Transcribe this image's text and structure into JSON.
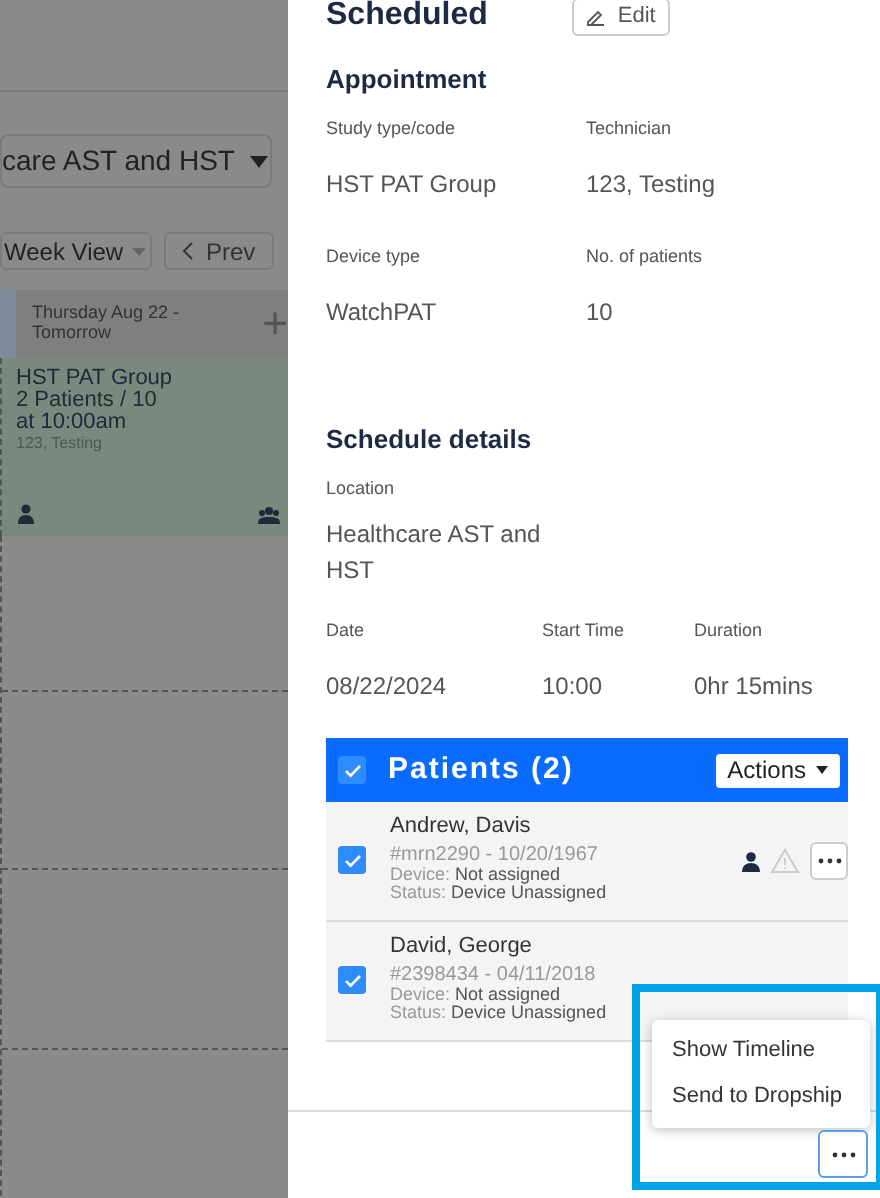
{
  "background": {
    "location_select": "care AST and HST",
    "view_select": "Week View",
    "prev_button": "Prev",
    "day_header": "Thursday Aug 22 - Tomorrow",
    "add_button": "+",
    "event": {
      "title": "HST PAT Group",
      "patients": "2 Patients / 10",
      "time": "at 10:00am",
      "technician": "123, Testing"
    }
  },
  "drawer": {
    "title": "Scheduled",
    "edit_button": "Edit",
    "appointment": {
      "heading": "Appointment",
      "fields": [
        {
          "label": "Study type/code",
          "value": "HST PAT Group"
        },
        {
          "label": "Technician",
          "value": "123, Testing"
        },
        {
          "label": "Device type",
          "value": "WatchPAT"
        },
        {
          "label": "No. of patients",
          "value": "10"
        }
      ]
    },
    "schedule": {
      "heading": "Schedule details",
      "location_label": "Location",
      "location": "Healthcare AST and HST",
      "fields": [
        {
          "label": "Date",
          "value": "08/22/2024"
        },
        {
          "label": "Start Time",
          "value": "10:00"
        },
        {
          "label": "Duration",
          "value": "0hr 15mins"
        }
      ]
    },
    "patients": {
      "title": "Patients (2)",
      "all_checked": true,
      "actions_button": "Actions",
      "rows": [
        {
          "name": "Andrew, Davis",
          "id": "#mrn2290 - 10/20/1967",
          "device_label": "Device:",
          "device": "Not assigned",
          "status_label": "Status:",
          "status": "Device Unassigned",
          "checked": true,
          "show_icons": true
        },
        {
          "name": "David, George",
          "id": "#2398434 - 04/11/2018",
          "device_label": "Device:",
          "device": "Not assigned",
          "status_label": "Status:",
          "status": "Device Unassigned",
          "checked": true,
          "show_icons": false
        }
      ]
    },
    "more_menu": {
      "open": true,
      "items": [
        "Show Timeline",
        "Send to Dropship"
      ]
    }
  }
}
